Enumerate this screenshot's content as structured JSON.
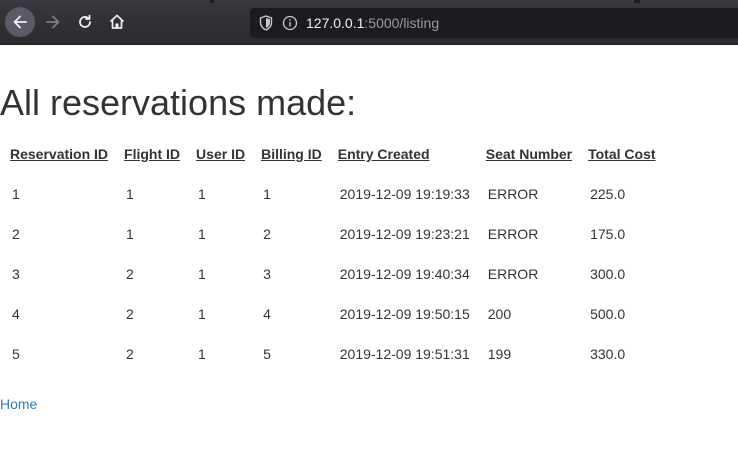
{
  "browser": {
    "url_host": "127.0.0.1",
    "url_rest": ":5000/listing"
  },
  "page": {
    "title": "All reservations made:",
    "home_link": "Home"
  },
  "table": {
    "headers": [
      "Reservation ID",
      "Flight ID",
      "User ID",
      "Billing ID",
      "Entry Created",
      "Seat Number",
      "Total Cost"
    ],
    "rows": [
      [
        "1",
        "1",
        "1",
        "1",
        "2019-12-09 19:19:33",
        "ERROR",
        "225.0"
      ],
      [
        "2",
        "1",
        "1",
        "2",
        "2019-12-09 19:23:21",
        "ERROR",
        "175.0"
      ],
      [
        "3",
        "2",
        "1",
        "3",
        "2019-12-09 19:40:34",
        "ERROR",
        "300.0"
      ],
      [
        "4",
        "2",
        "1",
        "4",
        "2019-12-09 19:50:15",
        "200",
        "500.0"
      ],
      [
        "5",
        "2",
        "1",
        "5",
        "2019-12-09 19:51:31",
        "199",
        "330.0"
      ]
    ]
  },
  "colors": {
    "link": "#337ab7",
    "text": "#333333",
    "toolbar": "#2b2a33"
  },
  "icons": [
    "back-arrow-icon",
    "forward-arrow-icon",
    "reload-icon",
    "home-icon",
    "shield-icon",
    "info-icon"
  ]
}
